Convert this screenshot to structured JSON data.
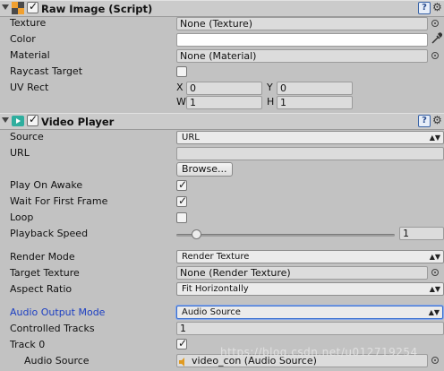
{
  "raw_image": {
    "title": "Raw Image (Script)",
    "icon": "raw-image-icon",
    "texture_label": "Texture",
    "texture_value": "None (Texture)",
    "color_label": "Color",
    "color_value": "#ffffff",
    "material_label": "Material",
    "material_value": "None (Material)",
    "raycast_label": "Raycast Target",
    "raycast_checked": false,
    "uv_label": "UV Rect",
    "uv": {
      "x_label": "X",
      "x": "0",
      "y_label": "Y",
      "y": "0",
      "w_label": "W",
      "w": "1",
      "h_label": "H",
      "h": "1"
    }
  },
  "video_player": {
    "title": "Video Player",
    "icon": "video-player-icon",
    "source_label": "Source",
    "source_value": "URL",
    "url_label": "URL",
    "url_value": "",
    "browse_label": "Browse...",
    "play_on_awake_label": "Play On Awake",
    "play_on_awake": true,
    "wait_label": "Wait For First Frame",
    "wait_first_frame": true,
    "loop_label": "Loop",
    "loop": false,
    "speed_label": "Playback Speed",
    "speed_value": "1",
    "speed_fraction": 0.09,
    "render_mode_label": "Render Mode",
    "render_mode_value": "Render Texture",
    "target_texture_label": "Target Texture",
    "target_texture_value": "None (Render Texture)",
    "aspect_label": "Aspect Ratio",
    "aspect_value": "Fit Horizontally",
    "audio_mode_label": "Audio Output Mode",
    "audio_mode_value": "Audio Source",
    "controlled_tracks_label": "Controlled Tracks",
    "controlled_tracks_value": "1",
    "track0_label": "Track 0",
    "track0_enabled": true,
    "audio_source_label": "Audio Source",
    "audio_source_value": "video_con (Audio Source)"
  },
  "watermark": "https://blog.csdn.net/u012719254",
  "colors": {
    "panel_bg": "#c2c2c2",
    "accent_blue": "#1c3fc2",
    "video_icon_teal": "#2fae9e"
  }
}
